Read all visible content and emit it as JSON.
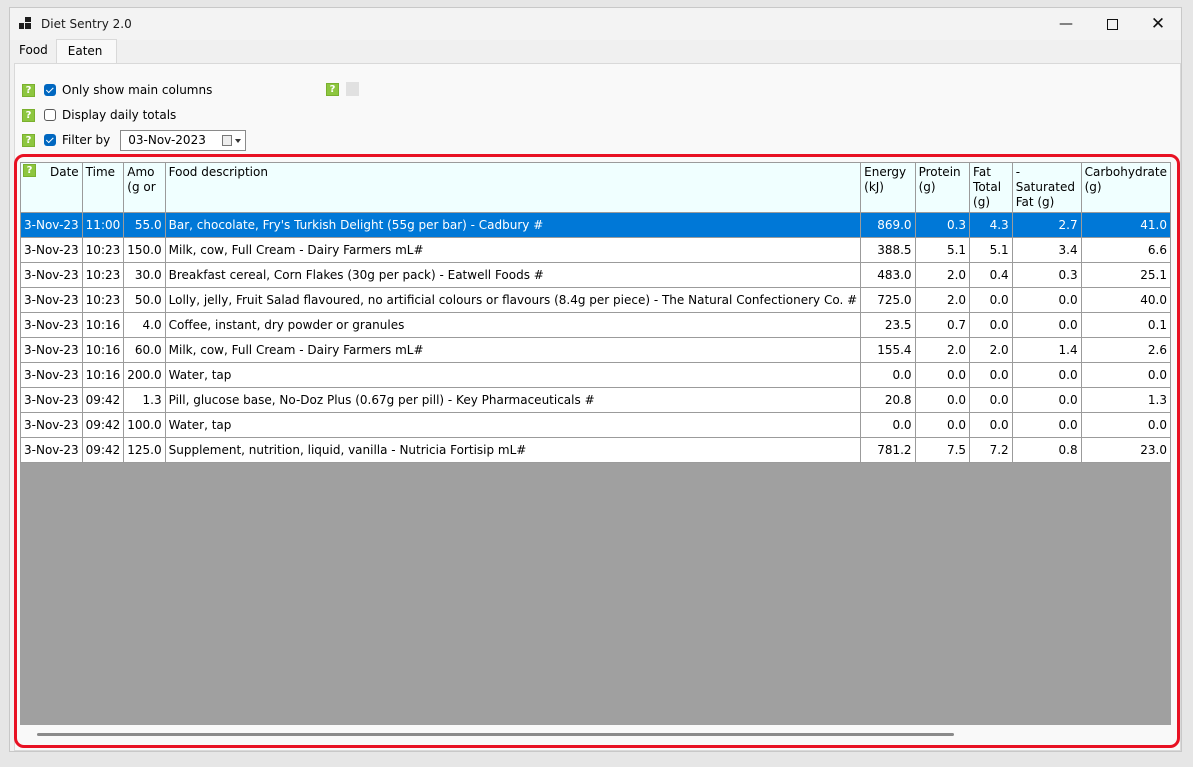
{
  "window": {
    "title": "Diet Sentry 2.0"
  },
  "tabs": [
    {
      "label": "Food"
    },
    {
      "label": "Eaten"
    }
  ],
  "options": {
    "help_glyph": "?",
    "only_main_columns_label": "Only show main columns",
    "daily_totals_label": "Display daily totals",
    "filter_by_label": "Filter by",
    "filter_date": "03-Nov-2023"
  },
  "table": {
    "headers": [
      "Date",
      "Time",
      "Amo (g or",
      "Food description",
      "Energy (kJ)",
      "Protein (g)",
      "Fat Total (g)",
      "-Saturated Fat (g)",
      "Carbohydrate (g)"
    ],
    "rows": [
      [
        "3-Nov-23",
        "11:00",
        "55.0",
        "Bar, chocolate, Fry's Turkish Delight (55g per bar) - Cadbury #",
        "869.0",
        "0.3",
        "4.3",
        "2.7",
        "41.0"
      ],
      [
        "3-Nov-23",
        "10:23",
        "150.0",
        "Milk, cow, Full Cream - Dairy Farmers mL#",
        "388.5",
        "5.1",
        "5.1",
        "3.4",
        "6.6"
      ],
      [
        "3-Nov-23",
        "10:23",
        "30.0",
        "Breakfast cereal, Corn Flakes (30g per pack) - Eatwell Foods #",
        "483.0",
        "2.0",
        "0.4",
        "0.3",
        "25.1"
      ],
      [
        "3-Nov-23",
        "10:23",
        "50.0",
        "Lolly, jelly, Fruit Salad flavoured, no artificial colours or flavours (8.4g per piece) - The Natural Confectionery Co. #",
        "725.0",
        "2.0",
        "0.0",
        "0.0",
        "40.0"
      ],
      [
        "3-Nov-23",
        "10:16",
        "4.0",
        "Coffee, instant, dry powder or granules",
        "23.5",
        "0.7",
        "0.0",
        "0.0",
        "0.1"
      ],
      [
        "3-Nov-23",
        "10:16",
        "60.0",
        "Milk, cow, Full Cream - Dairy Farmers mL#",
        "155.4",
        "2.0",
        "2.0",
        "1.4",
        "2.6"
      ],
      [
        "3-Nov-23",
        "10:16",
        "200.0",
        "Water, tap",
        "0.0",
        "0.0",
        "0.0",
        "0.0",
        "0.0"
      ],
      [
        "3-Nov-23",
        "09:42",
        "1.3",
        "Pill, glucose base, No-Doz Plus (0.67g per pill) - Key Pharmaceuticals #",
        "20.8",
        "0.0",
        "0.0",
        "0.0",
        "1.3"
      ],
      [
        "3-Nov-23",
        "09:42",
        "100.0",
        "Water, tap",
        "0.0",
        "0.0",
        "0.0",
        "0.0",
        "0.0"
      ],
      [
        "3-Nov-23",
        "09:42",
        "125.0",
        "Supplement, nutrition, liquid, vanilla -  Nutricia Fortisip mL#",
        "781.2",
        "7.5",
        "7.2",
        "0.8",
        "23.0"
      ]
    ]
  },
  "colors": {
    "selection": "#0078d7",
    "header_bg": "#f0ffff",
    "help_green": "#8dc63f",
    "highlight_frame": "#e81123"
  }
}
